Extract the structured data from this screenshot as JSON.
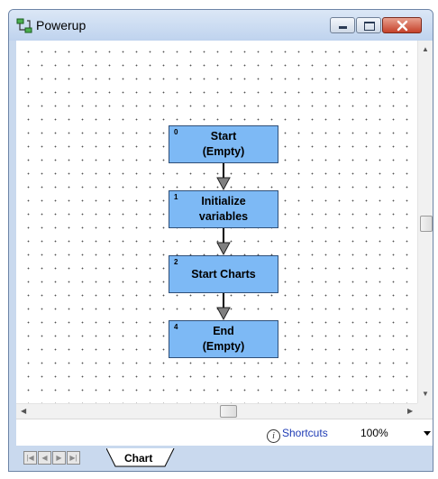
{
  "window": {
    "title": "Powerup",
    "buttons": [
      "minimize",
      "maximize",
      "close"
    ]
  },
  "chart": {
    "steps": [
      {
        "num": "0",
        "line1": "Start",
        "line2": "(Empty)"
      },
      {
        "num": "1",
        "line1": "Initialize",
        "line2": "variables"
      },
      {
        "num": "2",
        "line1": "Start Charts",
        "line2": ""
      },
      {
        "num": "4",
        "line1": "End",
        "line2": "(Empty)"
      }
    ]
  },
  "statusbar": {
    "shortcuts_label": "Shortcuts",
    "zoom": "100%"
  },
  "tabs": {
    "active": "Chart"
  },
  "colors": {
    "step_fill": "#7db9f5",
    "step_border": "#2f4f78",
    "shortcuts_link": "#1f3cb5"
  }
}
